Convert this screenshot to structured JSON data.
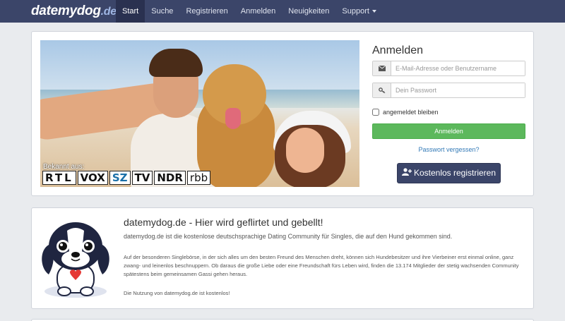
{
  "brand": {
    "name": "datemydog",
    "tld": ".de"
  },
  "nav": {
    "items": [
      {
        "label": "Start",
        "active": true
      },
      {
        "label": "Suche"
      },
      {
        "label": "Registrieren"
      },
      {
        "label": "Anmelden"
      },
      {
        "label": "Neuigkeiten"
      },
      {
        "label": "Support"
      }
    ]
  },
  "hero": {
    "known_from": "Bekannt aus:",
    "logos": [
      "RTL",
      "VOX",
      "SZ",
      "TV",
      "NDR",
      "rbb"
    ]
  },
  "login": {
    "title": "Anmelden",
    "email_placeholder": "E-Mail-Adresse oder Benutzername",
    "password_placeholder": "Dein Passwort",
    "remember_label": "angemeldet bleiben",
    "submit_label": "Anmelden",
    "forgot_label": "Passwort vergessen?",
    "register_label": "Kostenlos registrieren"
  },
  "about": {
    "title": "datemydog.de - Hier wird geflirtet und gebellt!",
    "lead": "datemydog.de ist die kostenlose deutschsprachige Dating Community für Singles, die auf den Hund gekommen sind.",
    "body": "Auf der besonderen Singlebörse, in der sich alles um den besten Freund des Menschen dreht, können sich Hundebesitzer und ihre Vierbeiner erst einmal online, ganz zwang- und leinenlos beschnuppern. Ob daraus die große Liebe oder eine Freundschaft fürs Leben wird, finden die 13.174 Mitglieder der stetig wachsenden Community spätestens beim gemeinsamen Gassi gehen heraus.",
    "free_note": "Die Nutzung von datemydog.de ist kostenlos!"
  },
  "colors": {
    "navbar": "#3b4569",
    "success": "#5cb85c",
    "link": "#337ab7"
  }
}
